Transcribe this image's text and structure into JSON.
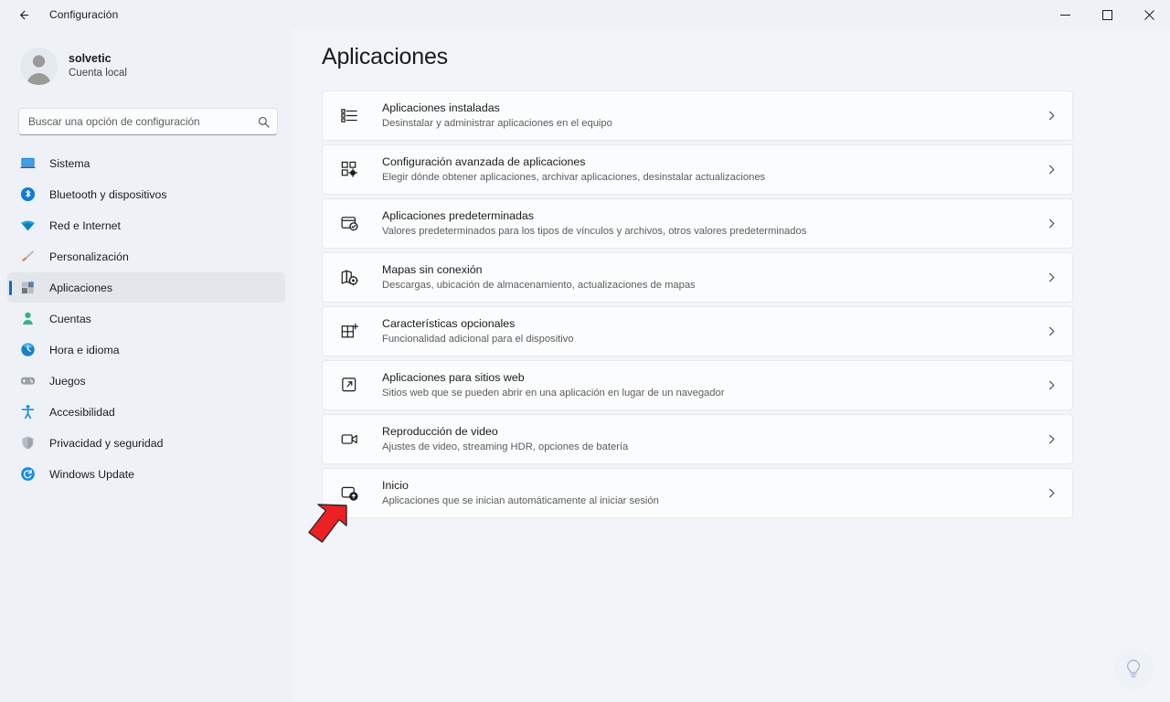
{
  "window": {
    "title": "Configuración",
    "back_label": "back-arrow",
    "minimize_label": "Minimizar",
    "maximize_label": "Maximizar",
    "close_label": "Cerrar"
  },
  "sidebar": {
    "account": {
      "name": "solvetic",
      "subtitle": "Cuenta local"
    },
    "search": {
      "placeholder": "Buscar una opción de configuración",
      "value": "",
      "icon": "search-icon"
    },
    "items": [
      {
        "label": "Sistema",
        "icon": "system-icon",
        "selected": false
      },
      {
        "label": "Bluetooth y dispositivos",
        "icon": "bluetooth-icon",
        "selected": false
      },
      {
        "label": "Red e Internet",
        "icon": "network-icon",
        "selected": false
      },
      {
        "label": "Personalización",
        "icon": "brush-icon",
        "selected": false
      },
      {
        "label": "Aplicaciones",
        "icon": "apps-icon",
        "selected": true
      },
      {
        "label": "Cuentas",
        "icon": "accounts-icon",
        "selected": false
      },
      {
        "label": "Hora e idioma",
        "icon": "clock-icon",
        "selected": false
      },
      {
        "label": "Juegos",
        "icon": "gamepad-icon",
        "selected": false
      },
      {
        "label": "Accesibilidad",
        "icon": "accessibility-icon",
        "selected": false
      },
      {
        "label": "Privacidad y seguridad",
        "icon": "shield-icon",
        "selected": false
      },
      {
        "label": "Windows Update",
        "icon": "update-icon",
        "selected": false
      }
    ]
  },
  "main": {
    "title": "Aplicaciones",
    "cards": [
      {
        "title": "Aplicaciones instaladas",
        "subtitle": "Desinstalar y administrar aplicaciones en el equipo",
        "icon": "installed-apps-list-icon",
        "chevron": "chevron-right-icon"
      },
      {
        "title": "Configuración avanzada de aplicaciones",
        "subtitle": "Elegir dónde obtener aplicaciones, archivar aplicaciones, desinstalar actualizaciones",
        "icon": "advanced-apps-settings-icon",
        "chevron": "chevron-right-icon"
      },
      {
        "title": "Aplicaciones predeterminadas",
        "subtitle": "Valores predeterminados para los tipos de vínculos y archivos, otros valores predeterminados",
        "icon": "default-apps-icon",
        "chevron": "chevron-right-icon"
      },
      {
        "title": "Mapas sin conexión",
        "subtitle": "Descargas, ubicación de almacenamiento, actualizaciones de mapas",
        "icon": "offline-maps-icon",
        "chevron": "chevron-right-icon"
      },
      {
        "title": "Características opcionales",
        "subtitle": "Funcionalidad adicional para el dispositivo",
        "icon": "optional-features-icon",
        "chevron": "chevron-right-icon"
      },
      {
        "title": "Aplicaciones para sitios web",
        "subtitle": "Sitios web que se pueden abrir en una aplicación en lugar de un navegador",
        "icon": "web-apps-icon",
        "chevron": "chevron-right-icon"
      },
      {
        "title": "Reproducción de video",
        "subtitle": "Ajustes de video, streaming HDR, opciones de batería",
        "icon": "video-playback-icon",
        "chevron": "chevron-right-icon"
      },
      {
        "title": "Inicio",
        "subtitle": "Aplicaciones que se inician automáticamente al iniciar sesión",
        "icon": "startup-apps-icon",
        "chevron": "chevron-right-icon"
      }
    ]
  },
  "annotation": {
    "arrow_color": "#ed2024",
    "arrow_target": "Inicio"
  },
  "feedback": {
    "icon": "lightbulb-icon"
  },
  "colors": {
    "accent": "#0f6cbd",
    "page_background": "#f1f4f8",
    "sidebar_background": "#eef2f7",
    "card_background": "#fbfcfd",
    "annotation_red": "#ed2024"
  }
}
